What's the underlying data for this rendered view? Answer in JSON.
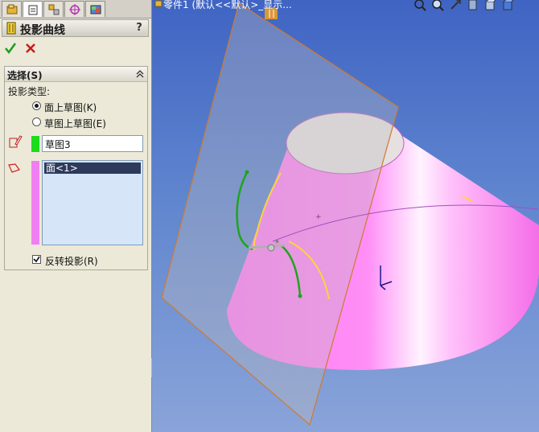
{
  "panel": {
    "title": "投影曲线",
    "help": "?",
    "tabs": [
      "feature-manager-icon",
      "property-manager-icon",
      "configuration-manager-icon",
      "dimxpert-icon",
      "display-manager-icon"
    ],
    "group": {
      "title": "选择(S)",
      "projection_type_label": "投影类型:",
      "options": [
        {
          "label": "面上草图(K)",
          "checked": true
        },
        {
          "label": "草图上草图(E)",
          "checked": false
        }
      ],
      "sketch_value": "草图3",
      "faces": [
        "面<1>"
      ],
      "reverse_label": "反转投影(R)",
      "reverse_checked": true
    },
    "colors": {
      "sketch": "#1ddb1d",
      "face": "#f27ff2"
    }
  },
  "viewport": {
    "tree_title": "零件1 (默认<<默认>_显示..."
  }
}
